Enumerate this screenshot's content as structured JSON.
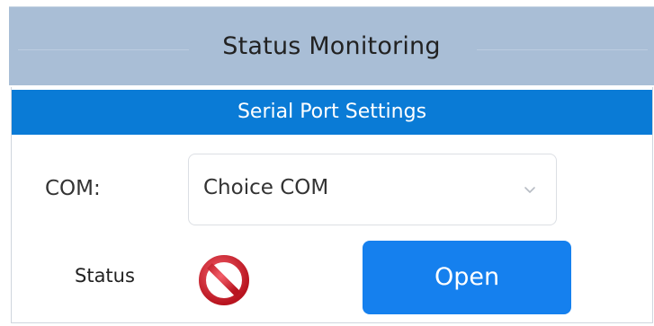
{
  "window": {
    "title": "Status Monitoring"
  },
  "serial_panel": {
    "header": "Serial Port Settings",
    "com_label": "COM:",
    "com_select": {
      "value": "Choice COM",
      "icon": "chevron-down-icon"
    },
    "status_label": "Status",
    "status_icon": "prohibited-icon",
    "open_button_label": "Open"
  },
  "colors": {
    "title_bar": "#a9bed6",
    "panel_header": "#0a7bd6",
    "button": "#1580ee",
    "status_icon": "#d7263d"
  }
}
